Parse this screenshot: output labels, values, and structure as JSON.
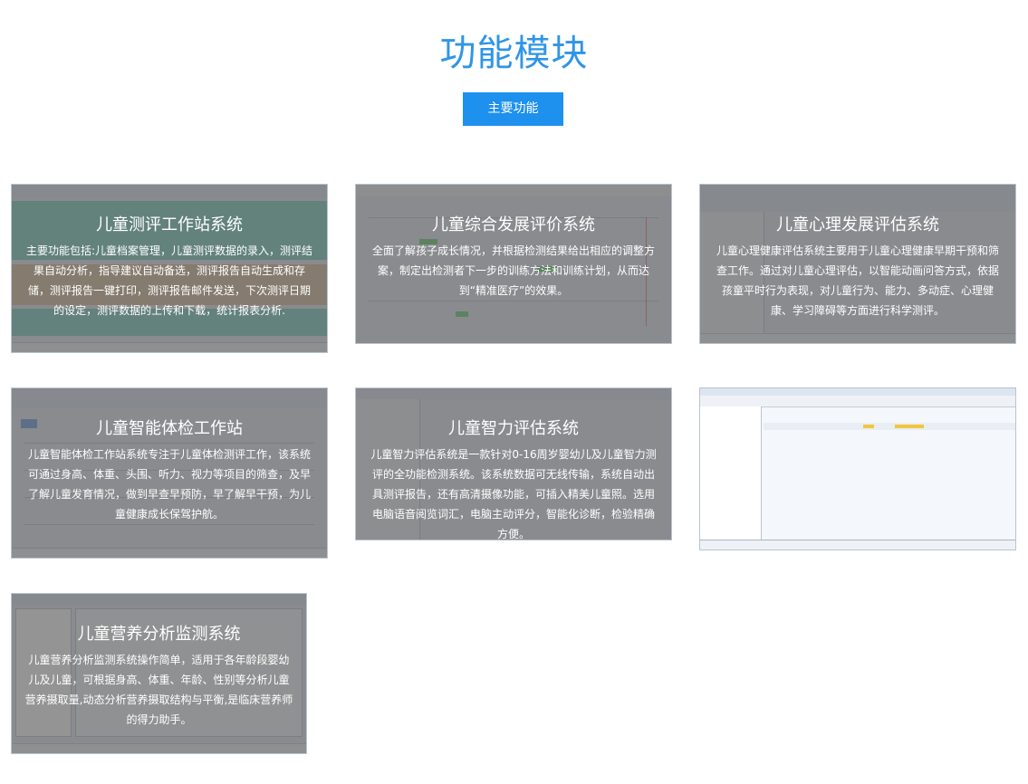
{
  "page": {
    "title": "功能模块",
    "tab_label": "主要功能"
  },
  "cards": [
    {
      "title": "儿童测评工作站系统",
      "desc": "主要功能包括:儿童档案管理，儿童测评数据的录入，测评结果自动分析，指导建议自动备选，测评报告自动生成和存储，测评报告一键打印，测评报告邮件发送，下次测评日期的设定，测评数据的上传和下载，统计报表分析."
    },
    {
      "title": "儿童综合发展评价系统",
      "desc": "全面了解孩子成长情况，并根据检测结果给出相应的调整方案，制定出检测者下一步的训练方法和训练计划，从而达到“精准医疗”的效果。"
    },
    {
      "title": "儿童心理发展评估系统",
      "desc": "儿童心理健康评估系统主要用于儿童心理健康早期干预和筛查工作。通过对儿童心理评估，以智能动画问答方式，依据孩童平时行为表现，对儿童行为、能力、多动症、心理健康、学习障碍等方面进行科学测评。"
    },
    {
      "title": "儿童智能体检工作站",
      "desc": "儿童智能体检工作站系统专注于儿童体检测评工作，该系统可通过身高、体重、头围、听力、视力等项目的筛查，及早了解儿童发育情况，做到早查早预防，早了解早干预，为儿童健康成长保驾护航。"
    },
    {
      "title": "儿童智力评估系统",
      "desc": "儿童智力评估系统是一款针对0-16周岁婴幼儿及儿童智力测评的全功能检测系统。该系统数据可无线传输，系统自动出具测评报告，还有高清摄像功能，可插入精美儿童照。选用电脑语音阅览词汇，电脑主动评分，智能化诊断，检验精确方便。"
    },
    {
      "title": "",
      "desc": ""
    },
    {
      "title": "儿童营养分析监测系统",
      "desc": "儿童营养分析监测系统操作简单，适用于各年龄段婴幼儿及儿童，可根据身高、体重、年龄、性别等分析儿童营养摄取量,动态分析营养摄取结构与平衡,是临床营养师的得力助手。"
    }
  ]
}
